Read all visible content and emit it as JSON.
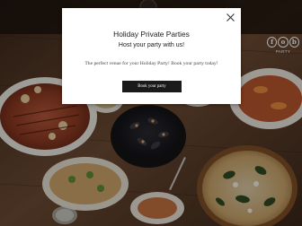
{
  "popup": {
    "title": "Holiday Private Parties",
    "subtitle": "Host your party with us!",
    "body": "The perfect venue for your Holiday Party! Book your party today!",
    "cta_label": "Book your party",
    "close_icon": "close-icon"
  },
  "logo": {
    "letters": [
      "f",
      "o",
      "b"
    ],
    "tagline": "PARTY"
  },
  "colors": {
    "overlay": "rgba(0,0,0,0.32)",
    "popup_bg": "#ffffff",
    "cta_bg": "#1a1a1a",
    "cta_text": "#ffffff"
  }
}
